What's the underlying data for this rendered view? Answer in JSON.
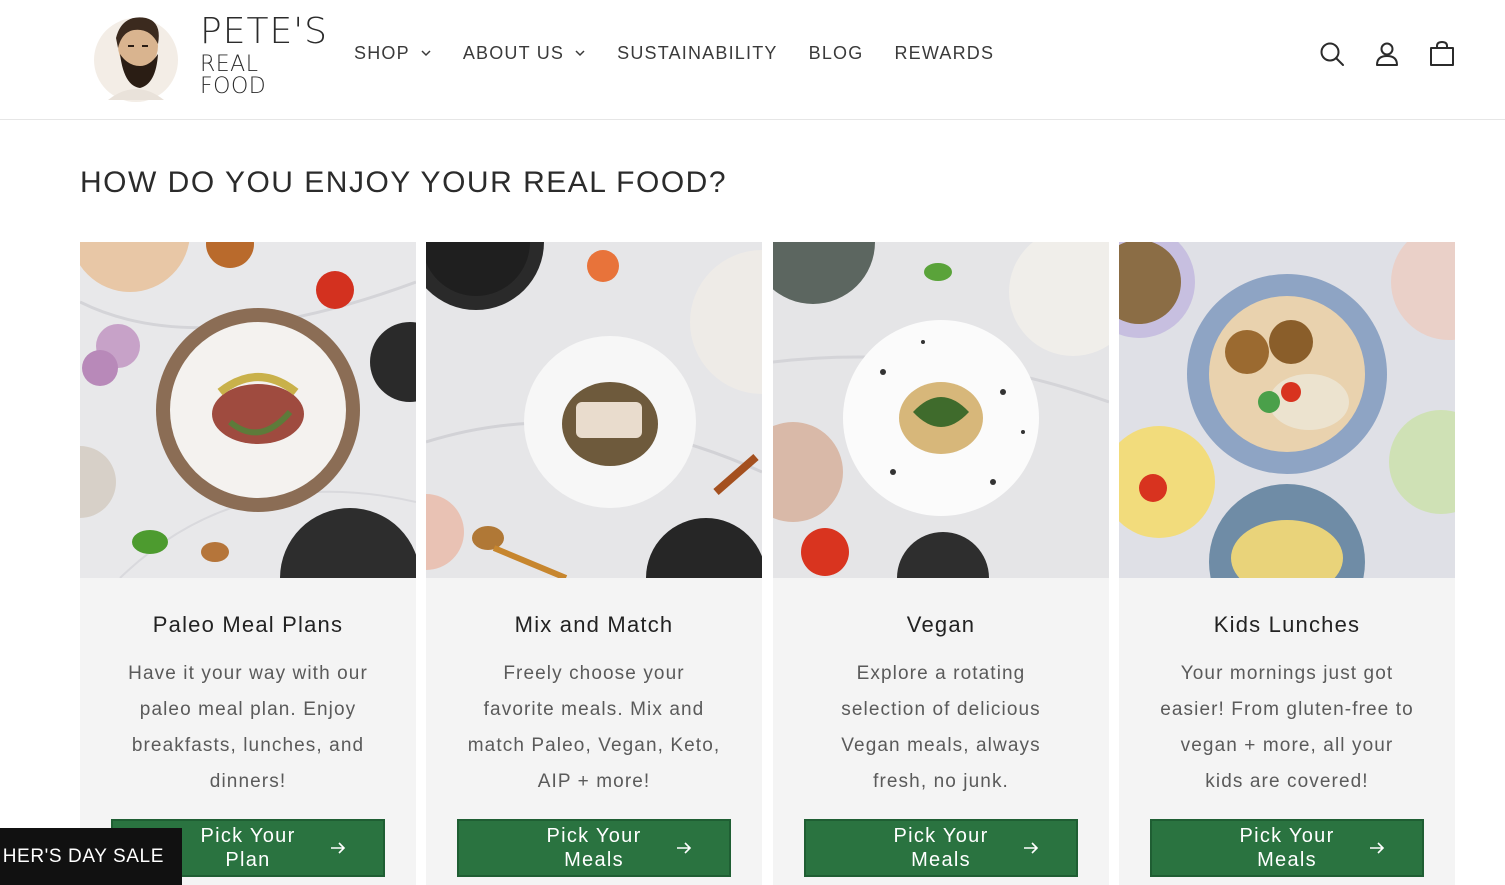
{
  "brand": {
    "line1": "PETE'S",
    "line2": "REAL FOOD"
  },
  "nav": {
    "items": [
      {
        "label": "SHOP",
        "has_dropdown": true
      },
      {
        "label": "ABOUT US",
        "has_dropdown": true
      },
      {
        "label": "SUSTAINABILITY",
        "has_dropdown": false
      },
      {
        "label": "BLOG",
        "has_dropdown": false
      },
      {
        "label": "REWARDS",
        "has_dropdown": false
      }
    ]
  },
  "header_icons": [
    "search-icon",
    "account-icon",
    "cart-icon"
  ],
  "section": {
    "title": "HOW DO YOU ENJOY YOUR REAL FOOD?"
  },
  "cards": [
    {
      "title": "Paleo Meal Plans",
      "description": "Have it your way with our paleo meal plan. Enjoy breakfasts, lunches, and dinners!",
      "button_label": "Pick Your Plan"
    },
    {
      "title": "Mix and Match",
      "description": "Freely choose your favorite meals. Mix and match Paleo, Vegan, Keto, AIP + more!",
      "button_label": "Pick Your Meals"
    },
    {
      "title": "Vegan",
      "description": "Explore a rotating selection of delicious Vegan meals, always fresh, no junk.",
      "button_label": "Pick Your Meals"
    },
    {
      "title": "Kids Lunches",
      "description": "Your mornings just got easier! From gluten-free to vegan + more, all your kids are covered!",
      "button_label": "Pick Your Meals"
    }
  ],
  "sale_tab": {
    "label": "HER'S DAY SALE"
  },
  "colors": {
    "button_green": "#2a7340",
    "card_bg": "#f4f4f4",
    "sale_tab_bg": "#111111"
  }
}
